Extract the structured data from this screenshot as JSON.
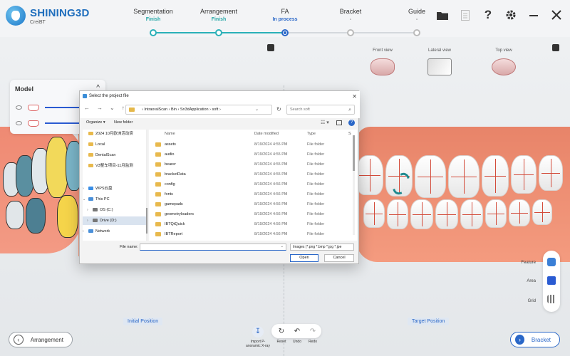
{
  "app": {
    "name": "SHINING3D",
    "subtitle": "CreiBT"
  },
  "steps": [
    {
      "name": "Segmentation",
      "status": "Finish",
      "state": "done"
    },
    {
      "name": "Arrangement",
      "status": "Finish",
      "state": "done"
    },
    {
      "name": "FA",
      "status": "In process",
      "state": "active"
    },
    {
      "name": "Bracket",
      "status": "-",
      "state": "pending"
    },
    {
      "name": "Guide",
      "status": "-",
      "state": "pending"
    }
  ],
  "top_icons": [
    "folder-icon",
    "file-icon",
    "help-icon",
    "gear-icon",
    "minimize-icon",
    "close-icon"
  ],
  "model_panel": {
    "title": "Model",
    "rows": [
      {
        "slider": 1.0
      },
      {
        "slider": 1.0
      }
    ]
  },
  "views": {
    "front": "Front view",
    "lateral": "Lateral view",
    "top": "Top view"
  },
  "right_tools": {
    "feature": "Feature",
    "area": "Area",
    "grid": "Grid"
  },
  "positions": {
    "initial": "Initial Position",
    "target": "Target Position"
  },
  "nav": {
    "prev": "Arrangement",
    "next": "Bracket"
  },
  "bottom_tools": {
    "import": "Import P-anoramic X-ray",
    "reset": "Reset",
    "undo": "Undo",
    "redo": "Redo"
  },
  "dialog": {
    "title": "Select the project file",
    "path": [
      "IntraoralScan",
      "Bin",
      "Sn3dApplication",
      "soft"
    ],
    "search_placeholder": "Search soft",
    "organize": "Organize ▾",
    "new_folder": "New folder",
    "nav_items": [
      {
        "label": "2024 10月欧洲活动资",
        "icon": "folder",
        "sel": false
      },
      {
        "label": "Local",
        "icon": "folder",
        "sel": false
      },
      {
        "label": "DentalScan",
        "icon": "folder",
        "sel": false
      },
      {
        "label": "V3整车项目-11月监测",
        "icon": "folder",
        "sel": false
      },
      {
        "label": "WPS云盘",
        "icon": "cloud",
        "sel": false,
        "chev": "›"
      },
      {
        "label": "This PC",
        "icon": "pc",
        "sel": false,
        "chev": "⌄"
      },
      {
        "label": "OS (C:)",
        "icon": "drive",
        "sel": false,
        "chev": "›"
      },
      {
        "label": "Drive (D:)",
        "icon": "drive",
        "sel": true,
        "chev": "›"
      },
      {
        "label": "Network",
        "icon": "net",
        "sel": false,
        "chev": "›"
      }
    ],
    "columns": {
      "name": "Name",
      "date": "Date modified",
      "type": "Type",
      "size": "S"
    },
    "files": [
      {
        "name": "assets",
        "date": "8/19/2024 4:55 PM",
        "type": "File folder"
      },
      {
        "name": "audio",
        "date": "8/19/2024 4:55 PM",
        "type": "File folder"
      },
      {
        "name": "bearer",
        "date": "8/19/2024 4:55 PM",
        "type": "File folder"
      },
      {
        "name": "bracketData",
        "date": "8/19/2024 4:55 PM",
        "type": "File folder"
      },
      {
        "name": "config",
        "date": "8/19/2024 4:56 PM",
        "type": "File folder"
      },
      {
        "name": "fonts",
        "date": "8/19/2024 4:56 PM",
        "type": "File folder"
      },
      {
        "name": "gamepads",
        "date": "8/19/2024 4:56 PM",
        "type": "File folder"
      },
      {
        "name": "geometryloaders",
        "date": "8/19/2024 4:56 PM",
        "type": "File folder"
      },
      {
        "name": "IBTQtQuick",
        "date": "8/19/2024 4:56 PM",
        "type": "File folder"
      },
      {
        "name": "IBTReport",
        "date": "8/19/2024 4:56 PM",
        "type": "File folder"
      }
    ],
    "file_name_label": "File name:",
    "file_name_value": "",
    "file_type": "Images (*.png *.bmp *.jpg *.jpe",
    "open": "Open",
    "cancel": "Cancel"
  },
  "colors": {
    "accent": "#2a67c8",
    "finish": "#2aa8a8",
    "gum": "#f0906f"
  }
}
